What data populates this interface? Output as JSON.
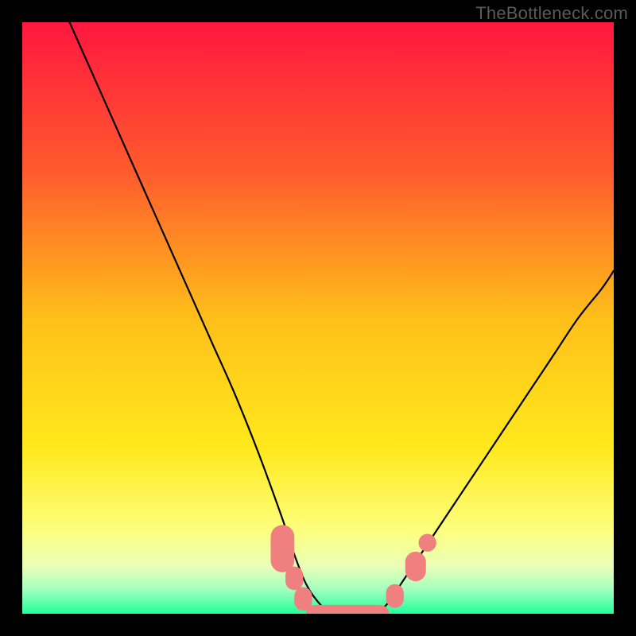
{
  "watermark": "TheBottleneck.com",
  "chart_data": {
    "type": "line",
    "title": "",
    "xlabel": "",
    "ylabel": "",
    "xlim": [
      0,
      100
    ],
    "ylim": [
      0,
      100
    ],
    "grid": false,
    "legend": false,
    "background_gradient_stops": [
      {
        "offset": 0.0,
        "color": "#ff173f"
      },
      {
        "offset": 0.25,
        "color": "#ff5a2d"
      },
      {
        "offset": 0.5,
        "color": "#ffbf19"
      },
      {
        "offset": 0.72,
        "color": "#ffe91c"
      },
      {
        "offset": 0.86,
        "color": "#fdff7e"
      },
      {
        "offset": 0.92,
        "color": "#e9ffb8"
      },
      {
        "offset": 0.96,
        "color": "#a0ffbe"
      },
      {
        "offset": 1.0,
        "color": "#20ff9c"
      }
    ],
    "series": [
      {
        "name": "left-curve",
        "type": "line",
        "x": [
          8,
          12,
          16,
          20,
          24,
          28,
          32,
          36,
          40,
          44,
          46,
          48,
          50,
          52
        ],
        "y": [
          100,
          91,
          82,
          73,
          64,
          55,
          46,
          37,
          27,
          16,
          10,
          5,
          2,
          0
        ]
      },
      {
        "name": "right-curve",
        "type": "line",
        "x": [
          60,
          62,
          64,
          66,
          70,
          74,
          78,
          82,
          86,
          90,
          94,
          98,
          100
        ],
        "y": [
          0,
          2,
          5,
          8,
          14,
          20,
          26,
          32,
          38,
          44,
          50,
          55,
          58
        ]
      },
      {
        "name": "flat-bottom",
        "type": "line",
        "x": [
          48,
          62
        ],
        "y": [
          0,
          0
        ]
      }
    ],
    "markers": [
      {
        "name": "bottom-cluster",
        "shape": "pill",
        "color": "#f08080",
        "points": [
          {
            "x": 44,
            "y": 11,
            "w": 4,
            "h": 8
          },
          {
            "x": 46,
            "y": 6,
            "w": 3,
            "h": 4
          },
          {
            "x": 47.5,
            "y": 2.5,
            "w": 3,
            "h": 4
          },
          {
            "x": 55,
            "y": 0,
            "w": 14,
            "h": 3
          },
          {
            "x": 63,
            "y": 3,
            "w": 3,
            "h": 4
          },
          {
            "x": 66.5,
            "y": 8,
            "w": 3.5,
            "h": 5
          },
          {
            "x": 68.5,
            "y": 12,
            "w": 3,
            "h": 3
          }
        ]
      }
    ]
  }
}
